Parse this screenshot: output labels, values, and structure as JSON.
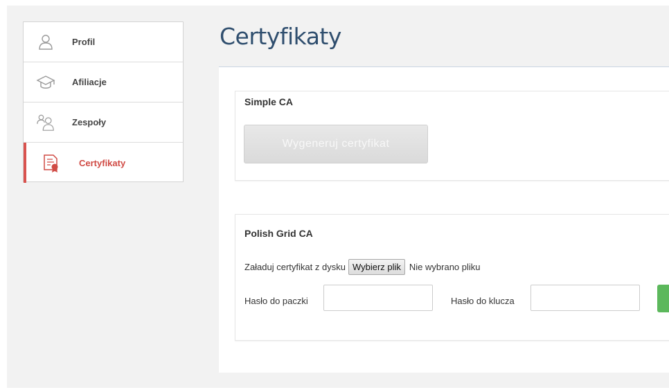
{
  "sidebar": {
    "items": [
      {
        "label": "Profil",
        "icon": "user-icon",
        "active": false
      },
      {
        "label": "Afiliacje",
        "icon": "graduation-cap-icon",
        "active": false
      },
      {
        "label": "Zespoły",
        "icon": "team-icon",
        "active": false
      },
      {
        "label": "Certyfikaty",
        "icon": "certificate-icon",
        "active": true
      }
    ]
  },
  "page": {
    "title": "Certyfikaty"
  },
  "simple_ca": {
    "heading": "Simple CA",
    "generate_button": "Wygeneruj certyfikat"
  },
  "polish_grid_ca": {
    "heading": "Polish Grid CA",
    "upload_label": "Załaduj certyfikat z dysku",
    "file_button": "Wybierz plik",
    "file_status": "Nie wybrano pliku",
    "package_password_label": "Hasło do paczki",
    "key_password_label": "Hasło do klucza"
  },
  "colors": {
    "accent_active": "#d04a44",
    "title": "#2f4e6e",
    "submit_green": "#5cb85c"
  }
}
